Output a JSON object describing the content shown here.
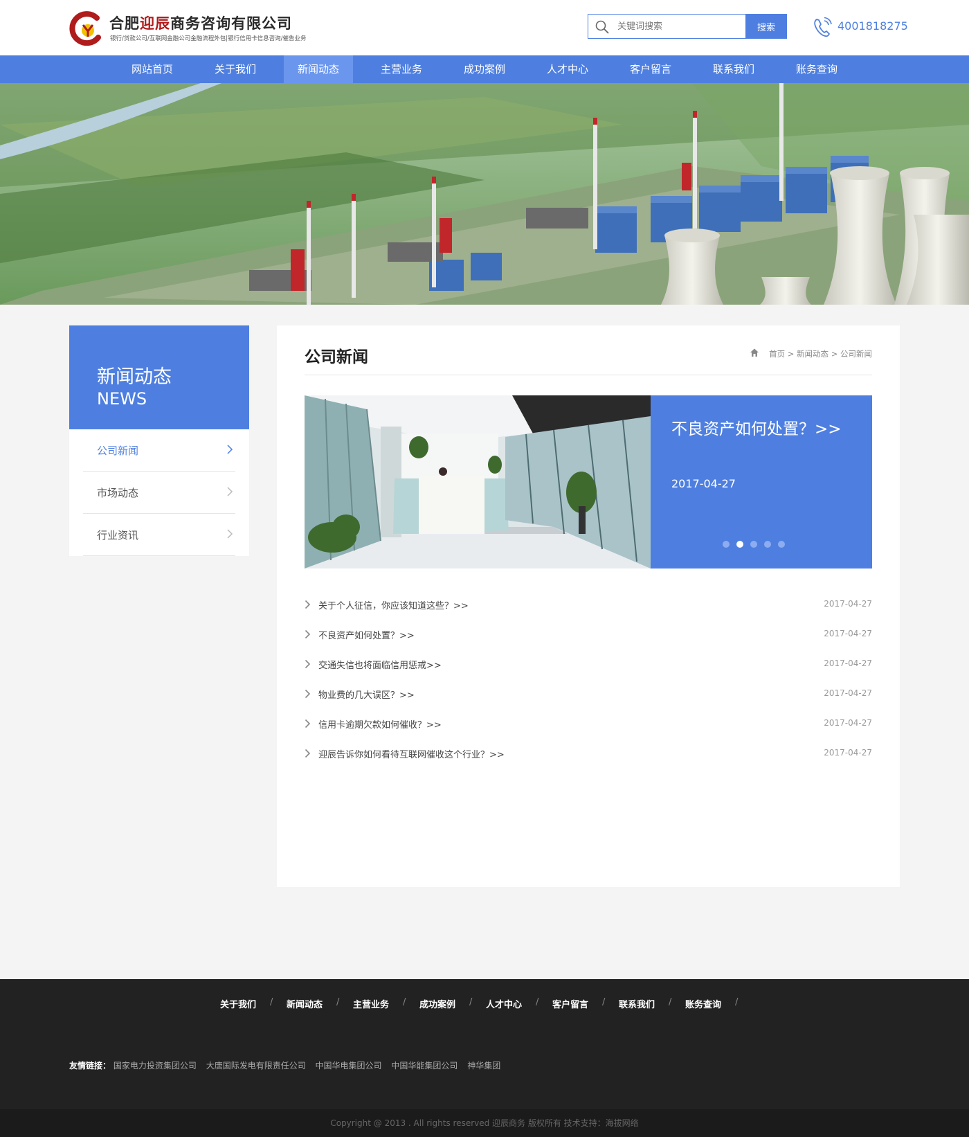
{
  "header": {
    "company_title_pre": "合肥",
    "company_title_hl": "迎辰",
    "company_title_post": "商务咨询有限公司",
    "company_subtitle": "银行/贷款公司/互联网金融公司金融流程外包|银行信用卡信息咨询/催告业务",
    "search_placeholder": "关键词搜索",
    "search_button": "搜索",
    "phone": "4001818275"
  },
  "nav": {
    "items": [
      "网站首页",
      "关于我们",
      "新闻动态",
      "主营业务",
      "成功案例",
      "人才中心",
      "客户留言",
      "联系我们",
      "账务查询"
    ],
    "active_index": 2
  },
  "sidebar": {
    "title": "新闻动态",
    "subtitle_en": "NEWS",
    "items": [
      "公司新闻",
      "市场动态",
      "行业资讯"
    ],
    "active_index": 0
  },
  "main": {
    "title": "公司新闻",
    "breadcrumb": [
      "首页",
      "新闻动态",
      "公司新闻"
    ],
    "breadcrumb_sep": ">",
    "feature": {
      "title": "不良资产如何处置？>>",
      "date": "2017-04-27",
      "slide_count": 5,
      "active_slide": 1
    },
    "news": [
      {
        "title": "关于个人征信，你应该知道这些？>>",
        "date": "2017-04-27"
      },
      {
        "title": "不良资产如何处置？>>",
        "date": "2017-04-27"
      },
      {
        "title": "交通失信也将面临信用惩戒>>",
        "date": "2017-04-27"
      },
      {
        "title": "物业费的几大误区？>>",
        "date": "2017-04-27"
      },
      {
        "title": "信用卡逾期欠款如何催收？>>",
        "date": "2017-04-27"
      },
      {
        "title": "迎辰告诉你如何看待互联网催收这个行业？>>",
        "date": "2017-04-27"
      }
    ]
  },
  "footer": {
    "nav": [
      "关于我们",
      "新闻动态",
      "主营业务",
      "成功案例",
      "人才中心",
      "客户留言",
      "联系我们",
      "账务查询"
    ],
    "sep": "/",
    "links_label": "友情链接：",
    "links": [
      "国家电力投资集团公司",
      "大唐国际发电有限责任公司",
      "中国华电集团公司",
      "中国华能集团公司",
      "神华集团"
    ],
    "copyright": "Copyright @ 2013 . All rights reserved 迎辰商务 版权所有 技术支持：海拔网络"
  },
  "colors": {
    "brand_blue": "#4e7fe0",
    "logo_red": "#b01b1b",
    "footer_bg": "#222222"
  },
  "icons": {
    "search": "magnifier-icon",
    "phone": "phone-icon",
    "home": "home-icon",
    "chevron": "chevron-right-icon"
  }
}
